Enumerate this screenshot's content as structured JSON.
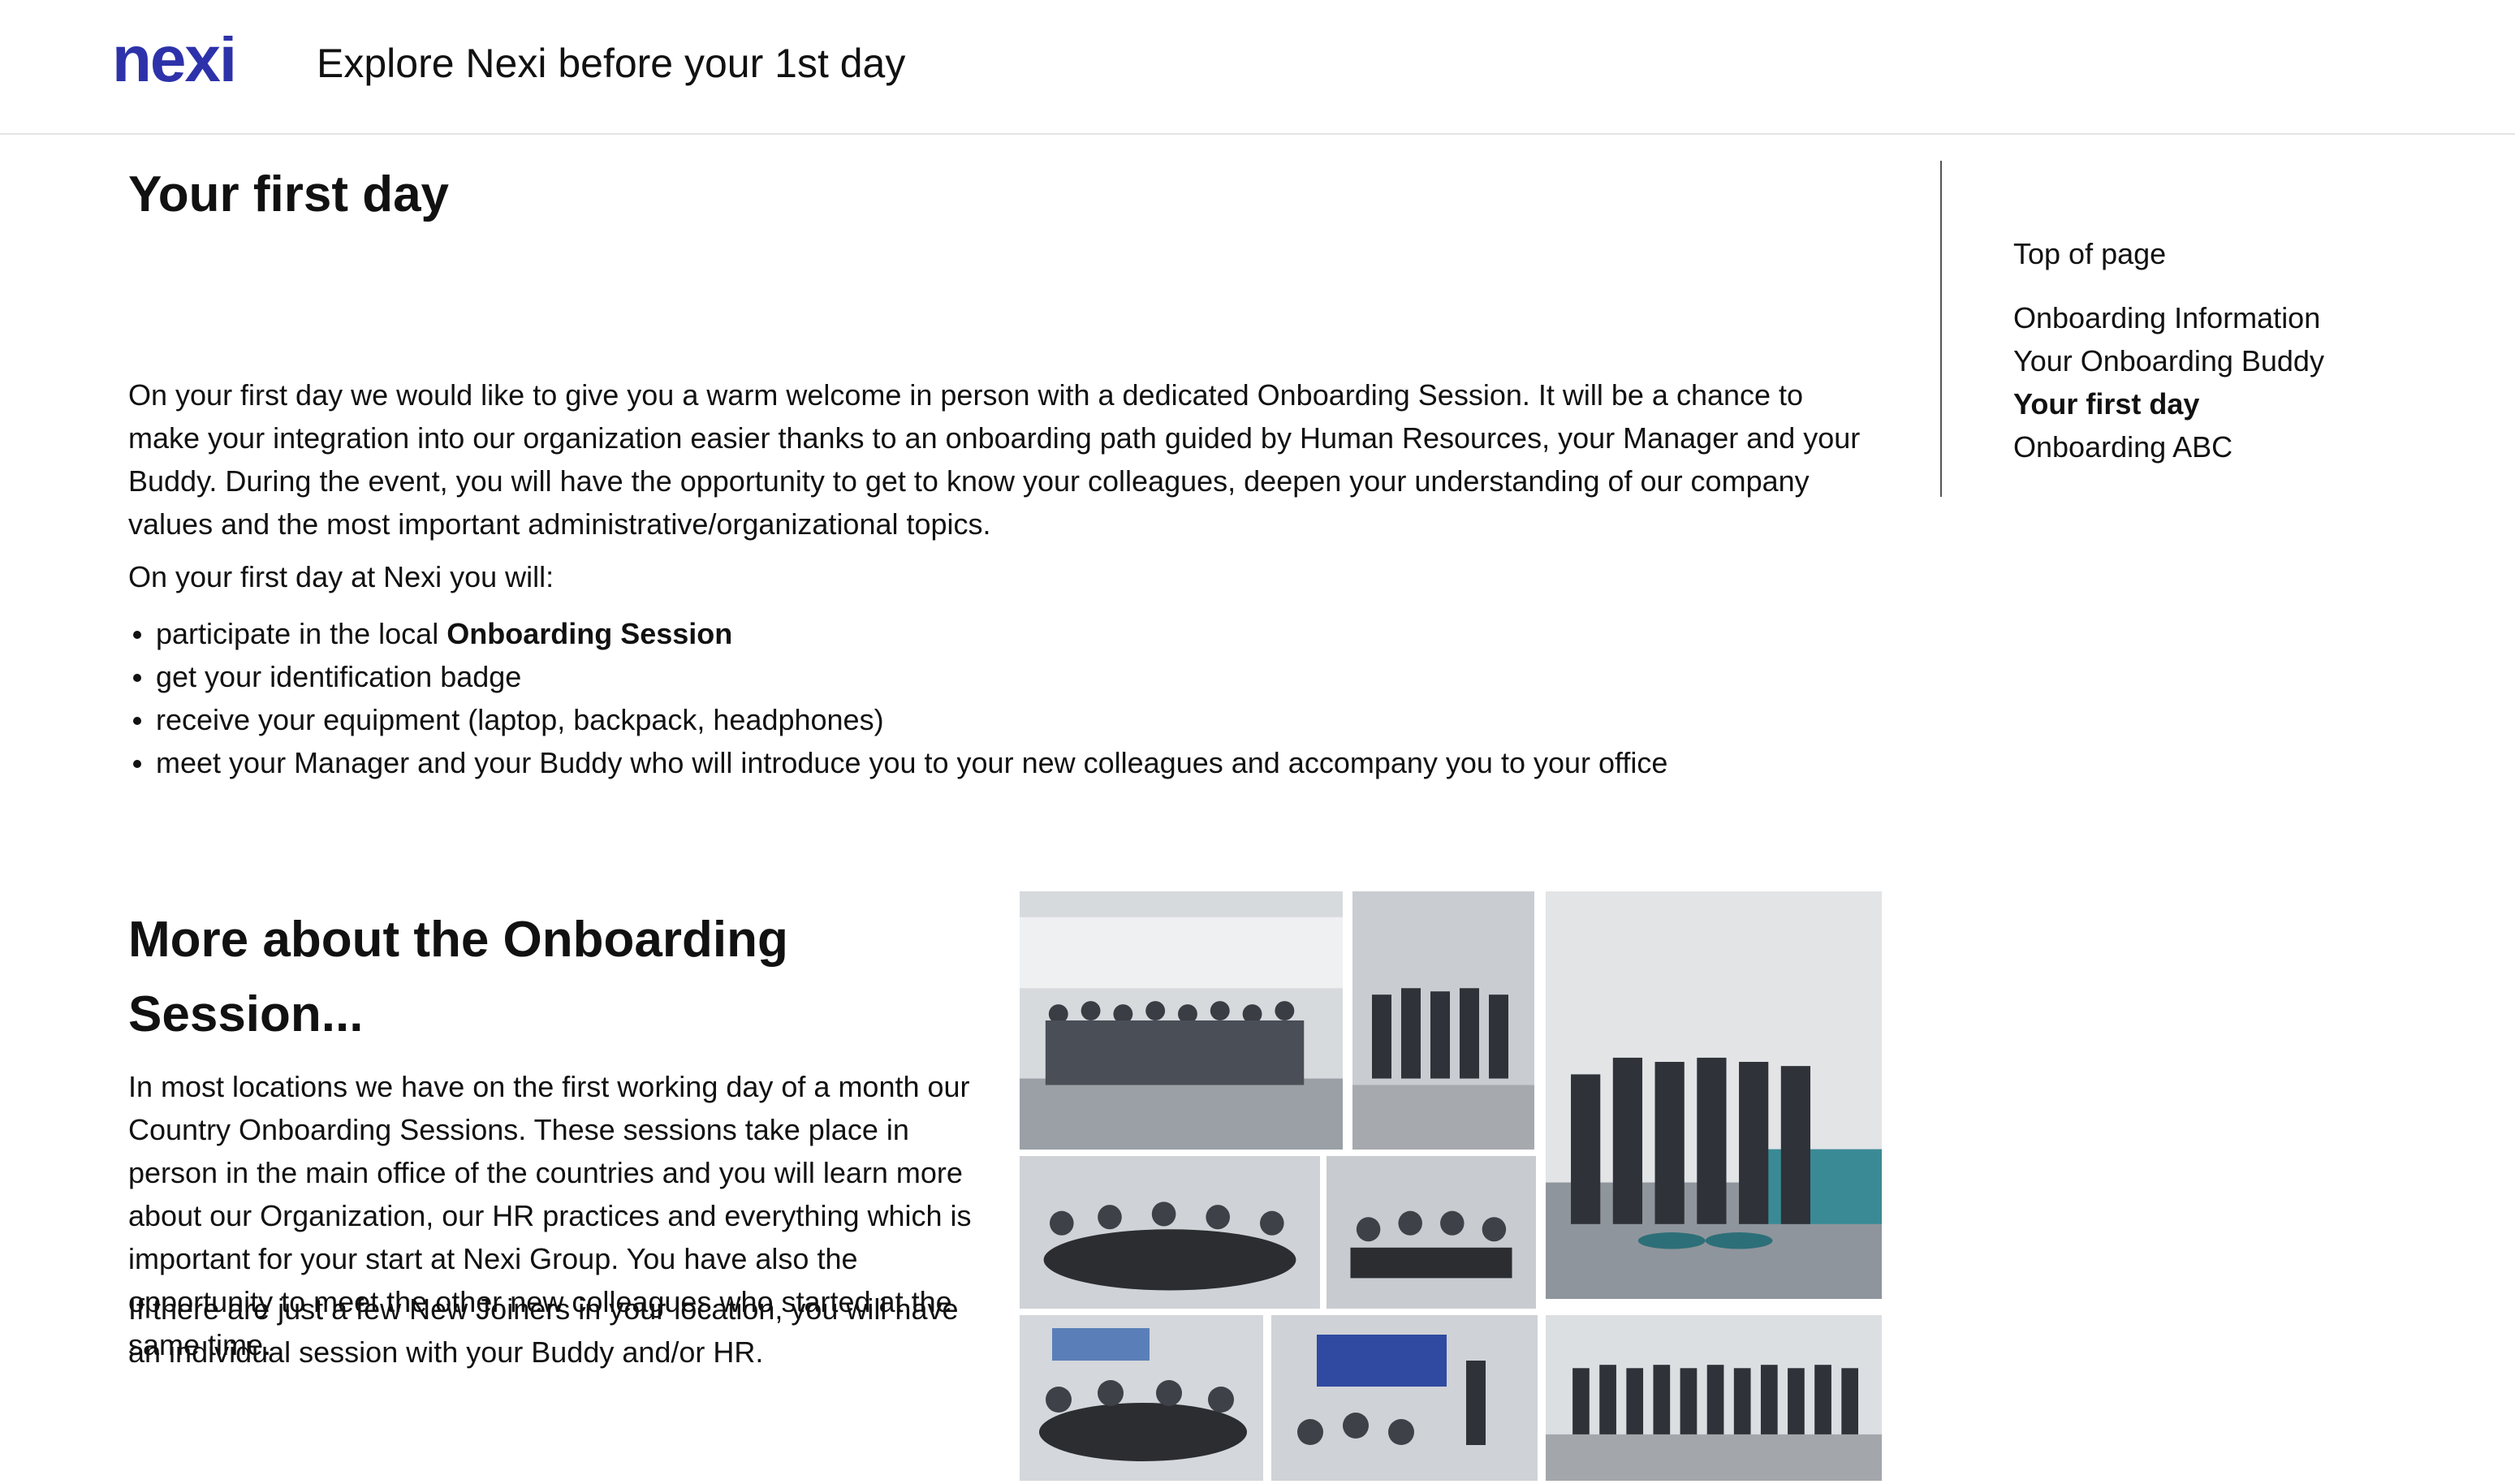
{
  "header": {
    "logo_text": "nexi",
    "title": "Explore Nexi before your 1st day"
  },
  "colors": {
    "brand": "#2d32aa",
    "text": "#111111"
  },
  "main": {
    "heading": "Your first day",
    "intro": "On your first day we would like to give you a warm welcome in person with a dedicated Onboarding Session. It will be a chance to make your integration into our organization easier thanks to an onboarding path guided by Human Resources, your Manager and your Buddy. During the event, you will have the opportunity to get to know your colleagues, deepen your understanding of our company values and the most important administrative/organizational topics.",
    "lead": "On your first day at Nexi you will:",
    "list": [
      {
        "text": "participate in the local ",
        "bold": "Onboarding Session"
      },
      {
        "text": "get your identification badge",
        "bold": ""
      },
      {
        "text": "receive your equipment (laptop, backpack, headphones)",
        "bold": ""
      },
      {
        "text": "meet your Manager and your Buddy who will introduce you to your new colleagues and accompany you to your office",
        "bold": ""
      }
    ]
  },
  "session": {
    "heading": "More about the Onboarding Session...",
    "p1": "In most locations we have on the first working day of a month our Country Onboarding Sessions. These sessions take place in person in the main office of the countries and you will learn more about our Organization, our HR practices and everything which is important for your start at Nexi Group. You have also the opportunity to meet the other new colleagues who started at the same time.",
    "p2": "If there are just a few New Joiners in your location, you will have an individual session with your Buddy and/or HR."
  },
  "toc": {
    "top": "Top of page",
    "items": [
      {
        "label": "Onboarding Information",
        "active": false
      },
      {
        "label": "Your Onboarding Buddy",
        "active": false
      },
      {
        "label": "Your first day",
        "active": true
      },
      {
        "label": "Onboarding ABC",
        "active": false
      }
    ]
  },
  "collage": {
    "photo_count": 8
  }
}
